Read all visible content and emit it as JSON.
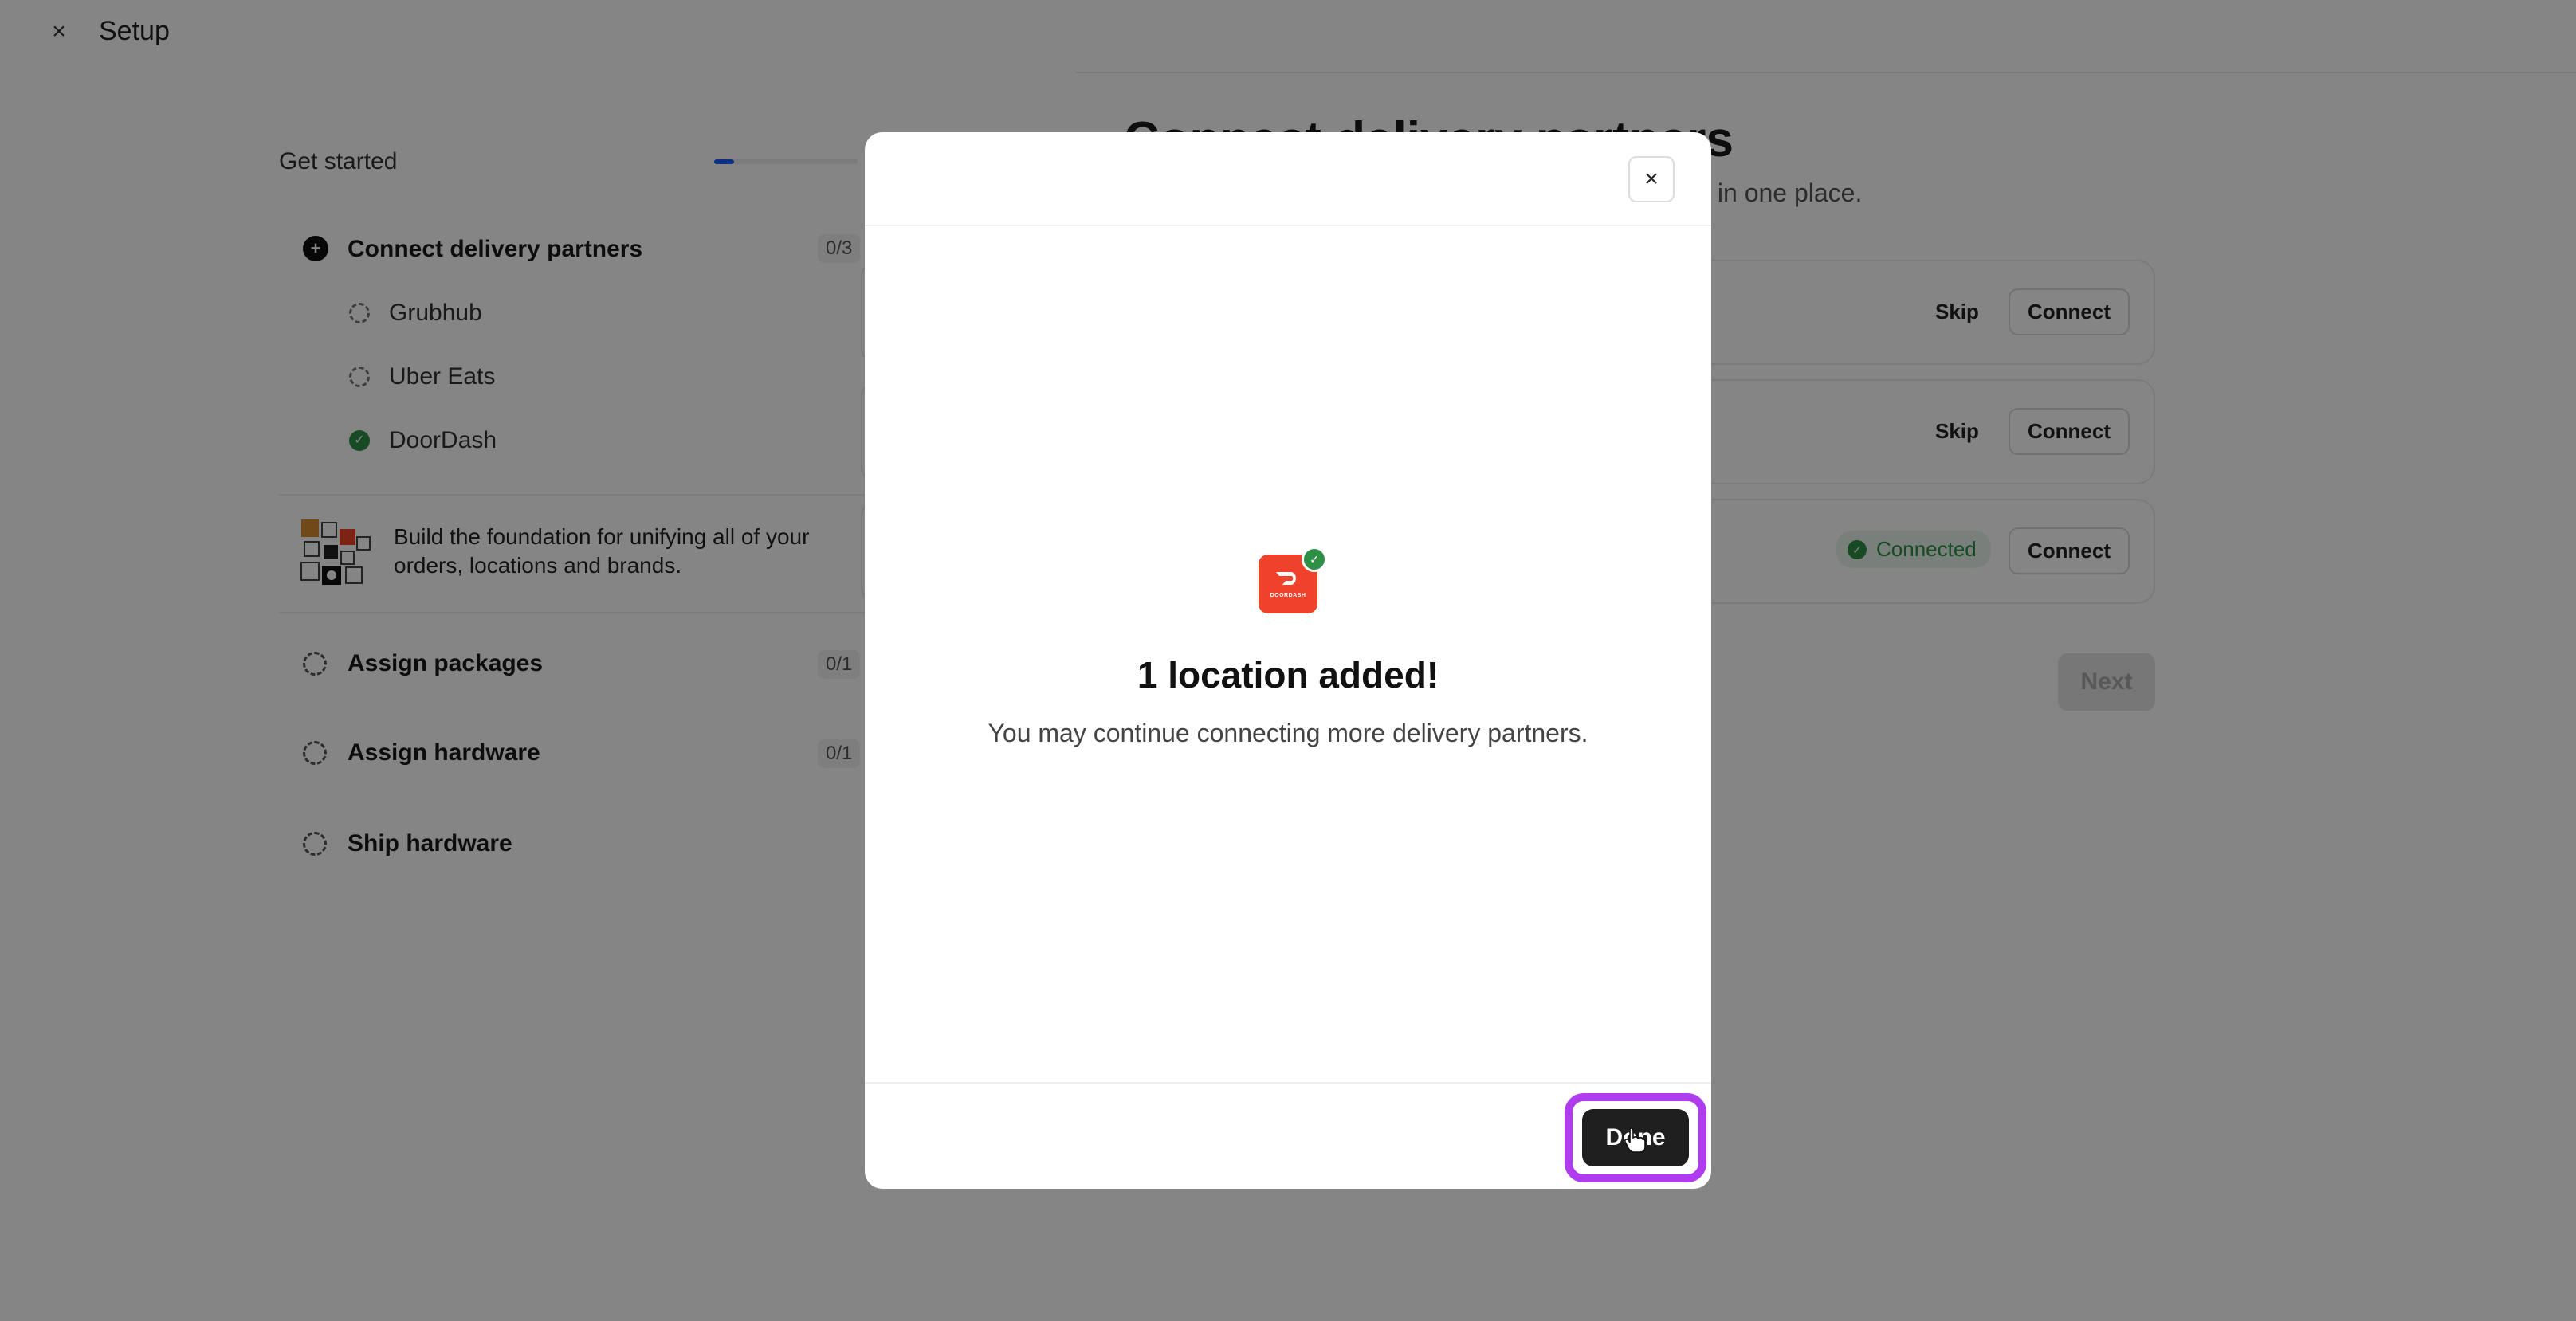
{
  "topbar": {
    "close_symbol": "×",
    "title": "Setup"
  },
  "sidebar": {
    "title": "Get started",
    "progress_fraction": 0.14,
    "steps": [
      {
        "label": "Connect delivery partners",
        "count": "0/3",
        "status": "active",
        "subitems": [
          {
            "label": "Grubhub",
            "status": "pending"
          },
          {
            "label": "Uber Eats",
            "status": "pending"
          },
          {
            "label": "DoorDash",
            "status": "done"
          }
        ]
      },
      {
        "label": "Assign packages",
        "count": "0/1",
        "status": "pending"
      },
      {
        "label": "Assign hardware",
        "count": "0/1",
        "status": "pending"
      },
      {
        "label": "Ship hardware",
        "count": "",
        "status": "pending"
      }
    ],
    "info_text": "Build the foundation for unifying all of your orders, locations and brands."
  },
  "main": {
    "title": "Connect delivery partners",
    "subtitle": "s in one place.",
    "rows": [
      {
        "skip_label": "Skip",
        "connect_label": "Connect"
      },
      {
        "skip_label": "Skip",
        "connect_label": "Connect"
      },
      {
        "status_label": "Connected",
        "connect_label": "Connect"
      }
    ],
    "next_label": "Next"
  },
  "modal": {
    "close_symbol": "×",
    "logo_text": "DOORDASH",
    "title": "1 location added!",
    "description": "You may continue connecting more delivery partners.",
    "done_label": "Done"
  },
  "colors": {
    "accent_highlight": "#b03cf0",
    "doordash_red": "#f0412a",
    "success_green": "#2f8f46",
    "progress_blue": "#1a5cff"
  },
  "icons": [
    "close-icon",
    "dashed-circle-icon",
    "check-circle-icon",
    "doordash-logo-icon",
    "cursor-icon"
  ]
}
